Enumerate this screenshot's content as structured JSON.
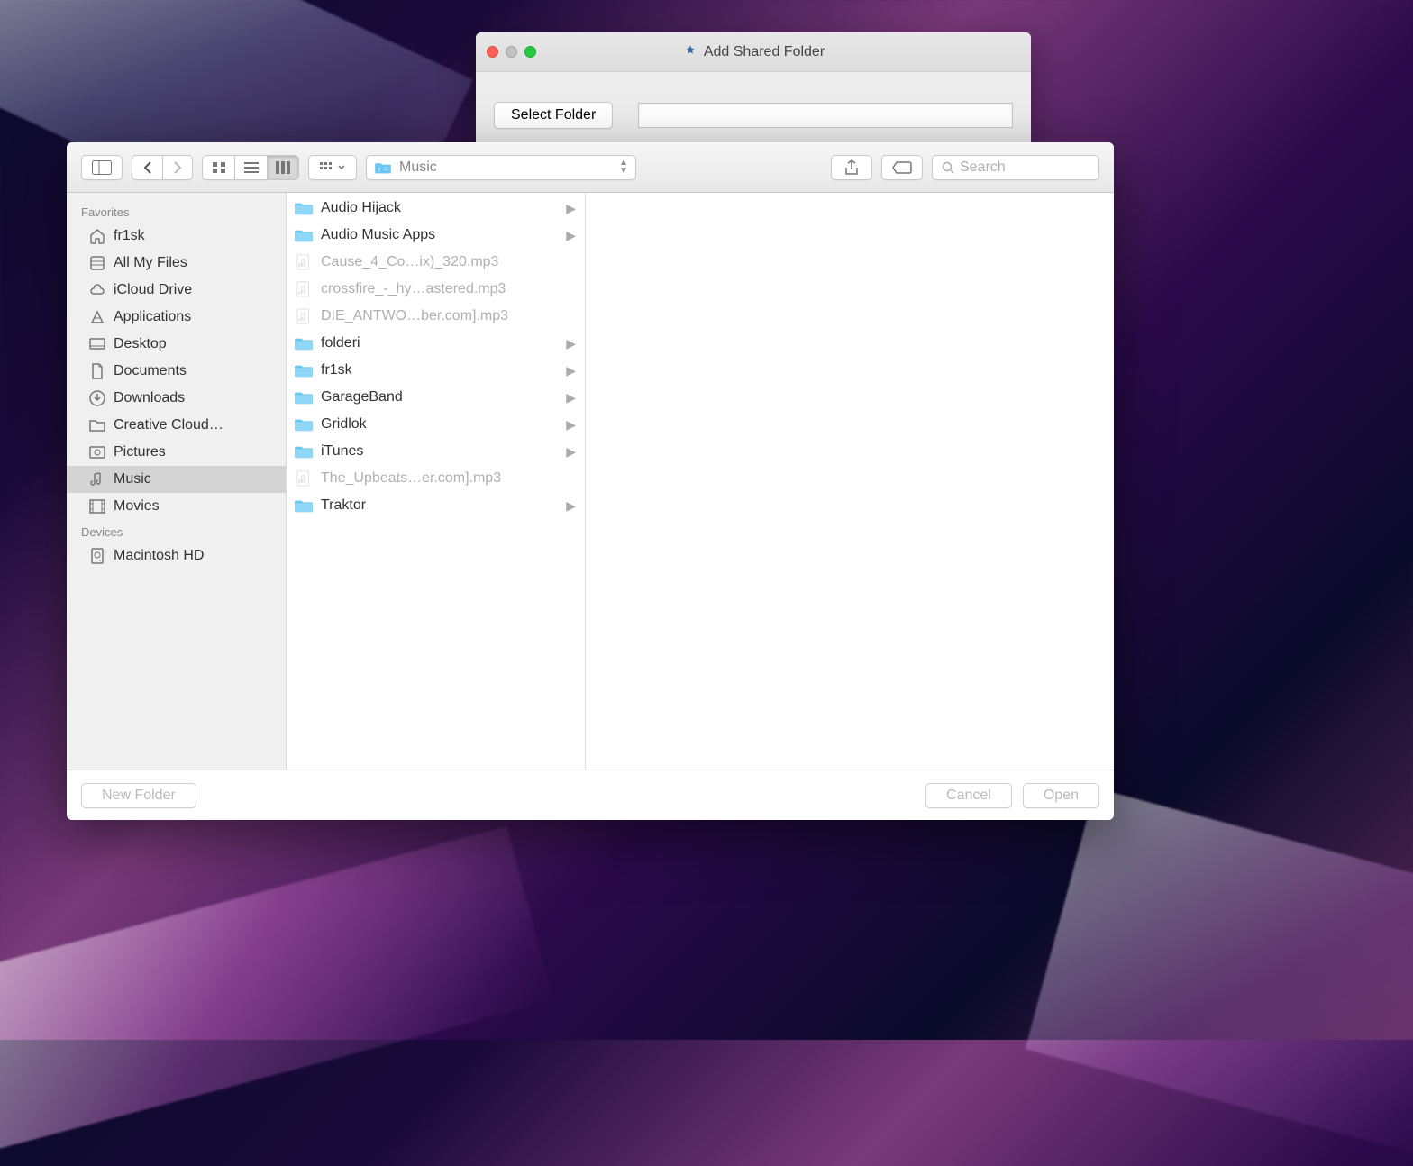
{
  "parent_window": {
    "title": "Add Shared Folder",
    "select_button": "Select Folder",
    "path_value": ""
  },
  "toolbar": {
    "path_label": "Music",
    "search_placeholder": "Search"
  },
  "sidebar": {
    "sections": [
      {
        "header": "Favorites",
        "items": [
          {
            "icon": "home",
            "label": "fr1sk",
            "selected": false
          },
          {
            "icon": "allfiles",
            "label": "All My Files",
            "selected": false
          },
          {
            "icon": "cloud",
            "label": "iCloud Drive",
            "selected": false
          },
          {
            "icon": "apps",
            "label": "Applications",
            "selected": false
          },
          {
            "icon": "desktop",
            "label": "Desktop",
            "selected": false
          },
          {
            "icon": "documents",
            "label": "Documents",
            "selected": false
          },
          {
            "icon": "downloads",
            "label": "Downloads",
            "selected": false
          },
          {
            "icon": "folder",
            "label": "Creative Cloud…",
            "selected": false
          },
          {
            "icon": "pictures",
            "label": "Pictures",
            "selected": false
          },
          {
            "icon": "music",
            "label": "Music",
            "selected": true
          },
          {
            "icon": "movies",
            "label": "Movies",
            "selected": false
          }
        ]
      },
      {
        "header": "Devices",
        "items": [
          {
            "icon": "hdd",
            "label": "Macintosh HD",
            "selected": false
          }
        ]
      }
    ]
  },
  "files": [
    {
      "type": "folder",
      "name": "Audio Hijack",
      "dimmed": false
    },
    {
      "type": "folder",
      "name": "Audio Music Apps",
      "dimmed": false
    },
    {
      "type": "file",
      "name": "Cause_4_Co…ix)_320.mp3",
      "dimmed": true
    },
    {
      "type": "file",
      "name": "crossfire_-_hy…astered.mp3",
      "dimmed": true
    },
    {
      "type": "file",
      "name": "DIE_ANTWO…ber.com].mp3",
      "dimmed": true
    },
    {
      "type": "folder",
      "name": "folderi",
      "dimmed": false
    },
    {
      "type": "folder",
      "name": "fr1sk",
      "dimmed": false
    },
    {
      "type": "folder",
      "name": "GarageBand",
      "dimmed": false
    },
    {
      "type": "folder",
      "name": "Gridlok",
      "dimmed": false
    },
    {
      "type": "folder",
      "name": "iTunes",
      "dimmed": false
    },
    {
      "type": "file",
      "name": "The_Upbeats…er.com].mp3",
      "dimmed": true
    },
    {
      "type": "folder",
      "name": "Traktor",
      "dimmed": false
    }
  ],
  "footer": {
    "new_folder": "New Folder",
    "cancel": "Cancel",
    "open": "Open"
  }
}
